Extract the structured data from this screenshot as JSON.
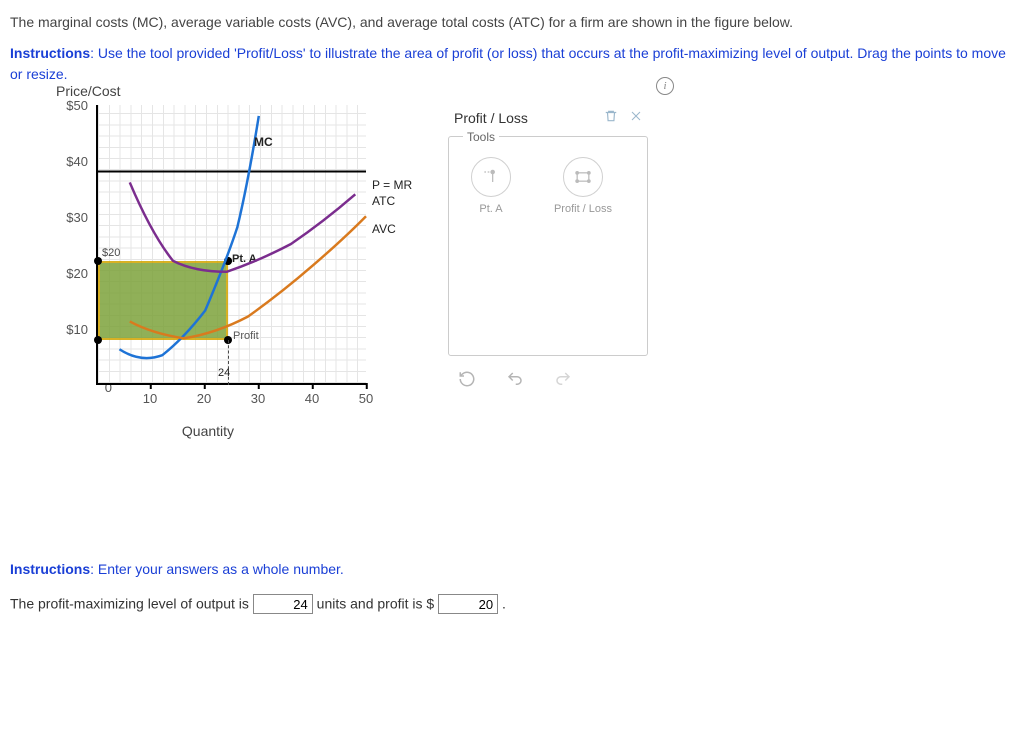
{
  "intro": "The marginal costs (MC), average variable costs (AVC), and average total costs (ATC) for a firm are shown in the figure below.",
  "instructions1_label": "Instructions",
  "instructions1_body": ": Use the tool provided 'Profit/Loss' to illustrate the area of profit (or loss) that occurs at the profit-maximizing level of output. Drag the points to move or resize.",
  "chart": {
    "y_title": "Price/Cost",
    "x_title": "Quantity",
    "y_ticks": [
      "$50",
      "$40",
      "$30",
      "$20",
      "$10",
      "0"
    ],
    "x_ticks": [
      "10",
      "20",
      "30",
      "40",
      "50"
    ],
    "rect_top_label": "$20",
    "pta_label": "Pt. A",
    "profit_label": "Profit",
    "q_marker": "24",
    "curve_mc": "MC",
    "curve_pmr": "P = MR",
    "curve_atc": "ATC",
    "curve_avc": "AVC"
  },
  "panel": {
    "title": "Profit / Loss",
    "section": "Tools",
    "tool1": "Pt. A",
    "tool2": "Profit / Loss"
  },
  "instructions2_label": "Instructions",
  "instructions2_body": ": Enter your answers as a whole number.",
  "answer": {
    "prefix": "The profit-maximizing level of output is ",
    "val1": "24",
    "mid": " units and profit is $ ",
    "val2": "20",
    "suffix": " ."
  },
  "chart_data": {
    "type": "line",
    "xlabel": "Quantity",
    "ylabel": "Price/Cost",
    "xlim": [
      0,
      50
    ],
    "ylim": [
      0,
      50
    ],
    "series": [
      {
        "name": "MC",
        "x": [
          4,
          8,
          12,
          16,
          20,
          24,
          26,
          28,
          30
        ],
        "y": [
          6,
          4,
          5,
          8,
          13,
          22,
          28,
          36,
          48
        ]
      },
      {
        "name": "ATC",
        "x": [
          6,
          10,
          14,
          18,
          24,
          30,
          36,
          42,
          48
        ],
        "y": [
          36,
          27,
          22,
          20,
          20,
          22,
          25,
          29,
          34
        ]
      },
      {
        "name": "AVC",
        "x": [
          6,
          10,
          16,
          22,
          28,
          34,
          40,
          46,
          50
        ],
        "y": [
          11,
          9,
          8,
          9,
          12,
          16,
          21,
          26,
          30
        ]
      },
      {
        "name": "P = MR",
        "x": [
          0,
          50
        ],
        "y": [
          38,
          38
        ]
      }
    ],
    "profit_rectangle": {
      "x0": 0,
      "x1": 24,
      "y0": 8,
      "y1": 22
    },
    "point_A": {
      "x": 24,
      "y": 22
    },
    "q_marker": 24,
    "annotations": [
      "$20",
      "Pt. A",
      "Profit",
      "24"
    ]
  }
}
